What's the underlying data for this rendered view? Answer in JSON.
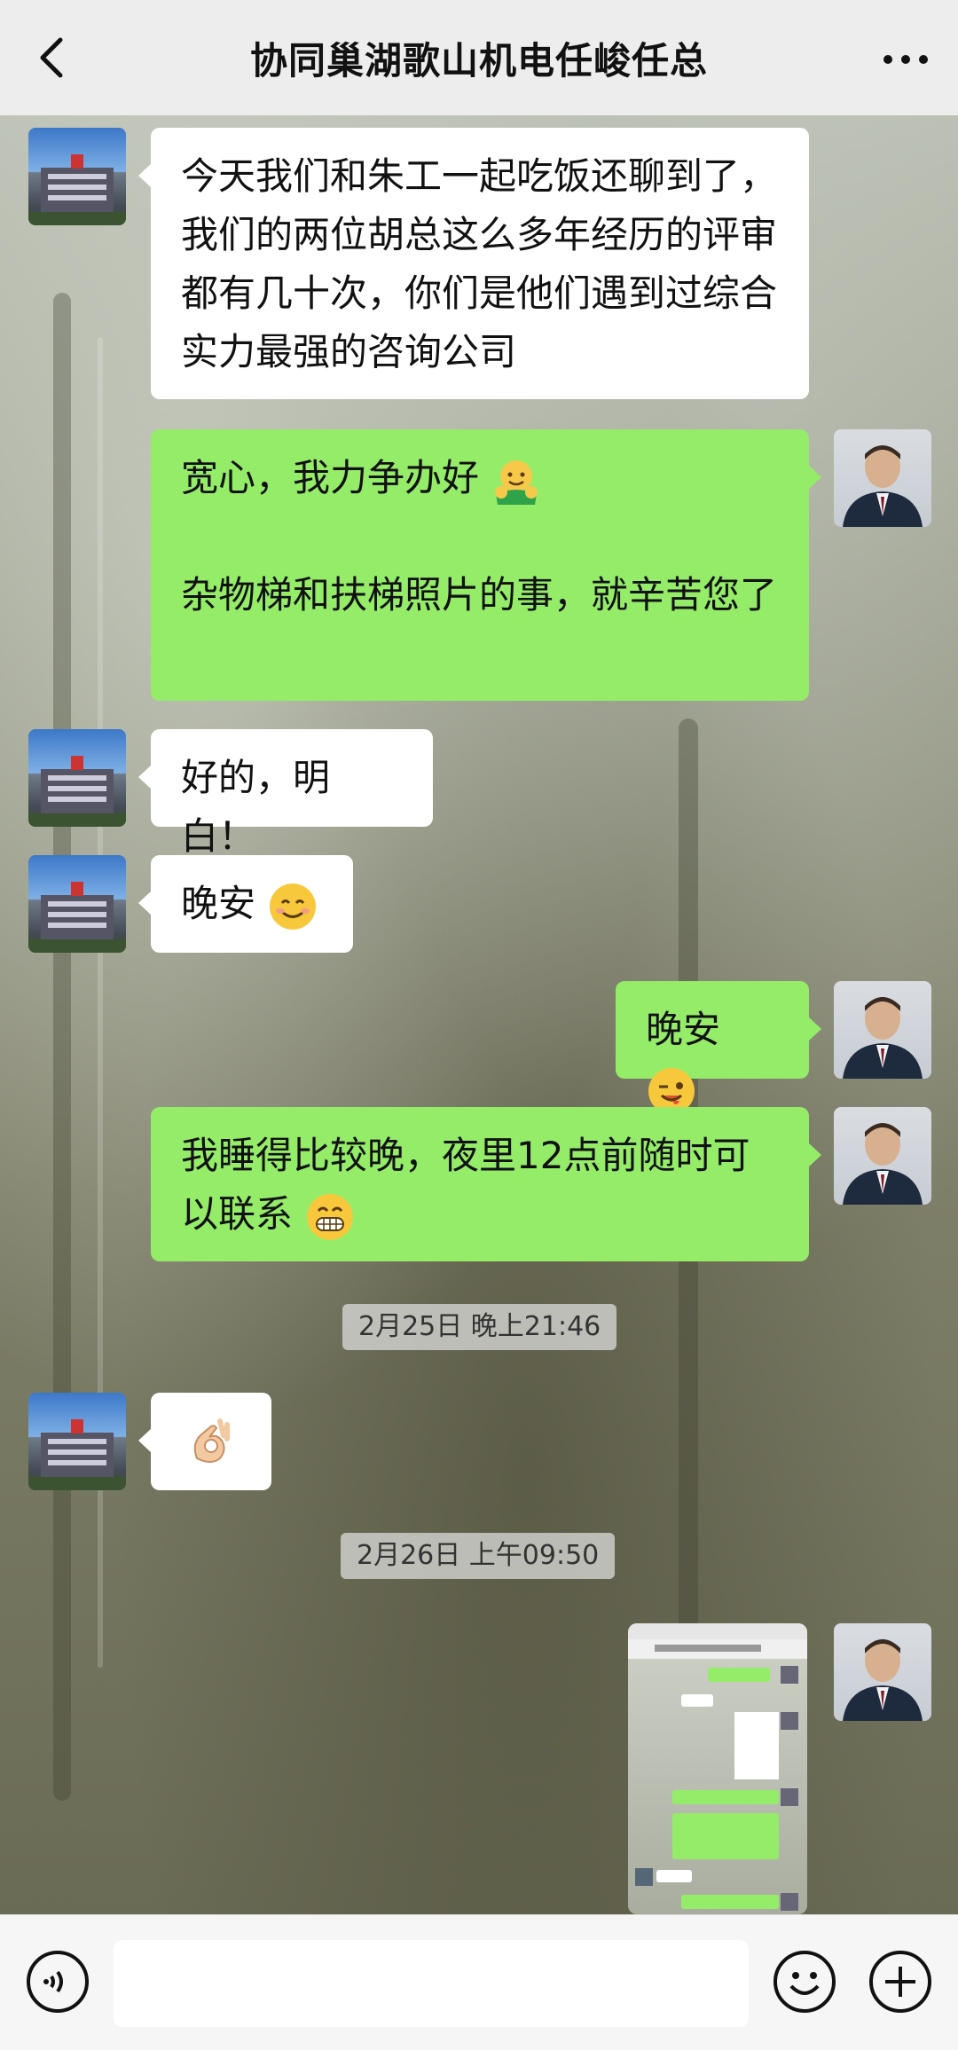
{
  "header": {
    "title": "协同巢湖歌山机电任峻任总",
    "back_icon": "chevron-left-icon",
    "more_icon": "more-dots-icon"
  },
  "messages": [
    {
      "side": "in",
      "text": "今天我们和朱工一起吃饭还聊到了，我们的两位胡总这么多年经历的评审都有几十次，你们是他们遇到过综合实力最强的咨询公司"
    },
    {
      "side": "out",
      "text": "宽心，我力争办好",
      "emoji": "hug-emoji",
      "text2": "杂物梯和扶梯照片的事，就辛苦您了"
    },
    {
      "side": "in",
      "text": "好的，明白！"
    },
    {
      "side": "in",
      "text": "晚安",
      "emoji": "smile-emoji"
    },
    {
      "side": "out",
      "text": "晚安",
      "emoji": "wink-emoji"
    },
    {
      "side": "out",
      "text": "我睡得比较晚，夜里12点前随时可以联系",
      "emoji": "grin-emoji"
    },
    {
      "side": "in",
      "emoji": "ok-hand-emoji"
    },
    {
      "side": "out",
      "type": "image",
      "description": "screenshot-thumbnail"
    }
  ],
  "timestamps": [
    "2月25日 晚上21:46",
    "2月26日 上午09:50"
  ],
  "bottom": {
    "voice_icon": "voice-icon",
    "emoji_icon": "emoji-icon",
    "plus_icon": "plus-icon"
  }
}
